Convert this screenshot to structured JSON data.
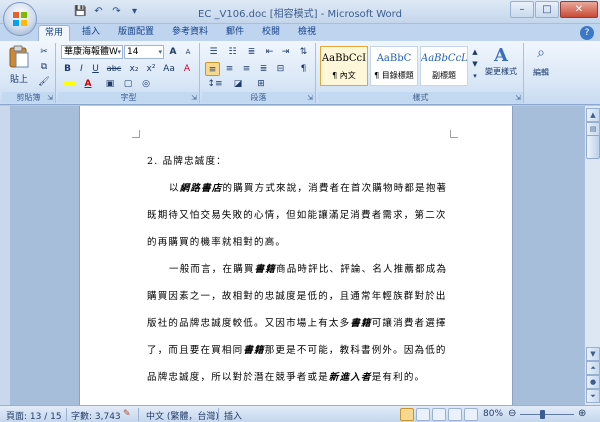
{
  "window": {
    "title": "EC _V106.doc [相容模式] - Microsoft Word",
    "controls": {
      "minimize": "–",
      "maximize": "□",
      "close": "✕"
    }
  },
  "qat": {
    "save": "💾",
    "undo": "↶",
    "redo": "↷",
    "customize": "▾"
  },
  "tabs": [
    "常用",
    "插入",
    "版面配置",
    "參考資料",
    "郵件",
    "校閱",
    "檢視"
  ],
  "help": "?",
  "ribbon": {
    "clipboard": {
      "label": "剪貼簿",
      "paste": "貼上"
    },
    "font": {
      "label": "字型",
      "font_name": "華康海報體W",
      "font_size": "14",
      "bold": "B",
      "italic": "I",
      "underline": "U",
      "strike": "abc",
      "subscript": "x₂",
      "superscript": "x²",
      "change_case": "Aa",
      "grow": "A",
      "shrink": "A",
      "clear": "A"
    },
    "paragraph": {
      "label": "段落",
      "show_marks": "¶"
    },
    "styles": {
      "label": "樣式",
      "items": [
        {
          "sample": "AaBbCcI",
          "name": "¶ 內文"
        },
        {
          "sample": "AaBbC",
          "name": "¶ 目錄標題"
        },
        {
          "sample": "AaBbCcL",
          "name": "副標題"
        }
      ],
      "change_styles": "變更樣式"
    },
    "editing": {
      "label": "編輯"
    }
  },
  "document": {
    "heading": "2. 品牌忠誠度：",
    "paragraphs": [
      [
        {
          "t": "以"
        },
        {
          "t": "網路書店",
          "em": true
        },
        {
          "t": "的購買方式來說，消費者在首次購物時都是抱著"
        }
      ],
      [
        {
          "t": "既期待又怕交易失敗的心情，但如能讓滿足消費者需求，第二次"
        }
      ],
      [
        {
          "t": "的再購買的機率就相對的高。"
        }
      ],
      [
        {
          "t": "一般而言，在購買"
        },
        {
          "t": "書籍",
          "em": true
        },
        {
          "t": "商品時評比、評論、名人推薦都成為"
        }
      ],
      [
        {
          "t": "購買因素之一，故相對的忠誠度是低的，且通常年輕族群對於出"
        }
      ],
      [
        {
          "t": "版社的品牌忠誠度較低。又因市場上有太多"
        },
        {
          "t": "書籍",
          "em": true
        },
        {
          "t": "可讓消費者選擇"
        }
      ],
      [
        {
          "t": "了，而且要在買相同"
        },
        {
          "t": "書籍",
          "em": true
        },
        {
          "t": "那更是不可能，教科書例外。因為低的"
        }
      ],
      [
        {
          "t": "品牌忠誠度，所以對於潛在競爭者或是"
        },
        {
          "t": "新進入者",
          "em": true
        },
        {
          "t": "是有利的。"
        }
      ]
    ]
  },
  "status": {
    "page": "頁面: 13 / 15",
    "words": "字數: 3,743",
    "language": "中文 (繁體，台灣)",
    "mode": "插入",
    "zoom": "80%",
    "zoom_out": "⊖",
    "zoom_in": "⊕"
  },
  "colors": {
    "ribbon_text": "#15428b",
    "doc_background": "#a7bedb",
    "accent": "#e3a83d"
  }
}
